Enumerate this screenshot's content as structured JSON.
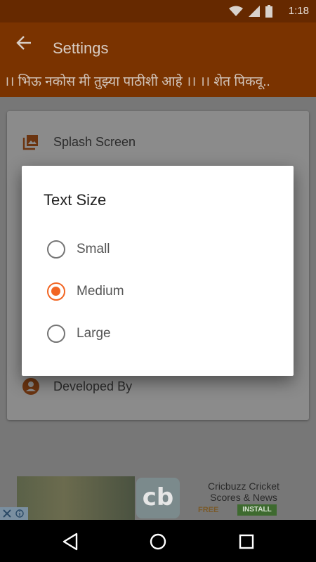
{
  "status_bar": {
    "time": "1:18"
  },
  "app_bar": {
    "title": "Settings"
  },
  "marquee": {
    "text": "।। भिऊ नकोस मी तुझ्या पाठीशी आहे ।। ।। शेत पिकवू.."
  },
  "settings": {
    "items": [
      {
        "label": "Splash Screen",
        "icon": "image-gallery-icon"
      },
      {
        "label": "Developed By",
        "icon": "account-icon"
      }
    ]
  },
  "dialog": {
    "title": "Text Size",
    "options": [
      {
        "label": "Small",
        "selected": false
      },
      {
        "label": "Medium",
        "selected": true
      },
      {
        "label": "Large",
        "selected": false
      }
    ]
  },
  "ad": {
    "app_name": "Cricbuzz Cricket Scores & News",
    "logo_text": "cb",
    "price": "FREE",
    "cta": "INSTALL"
  },
  "colors": {
    "accent": "#f26522",
    "app_bar": "#7a3300",
    "status_bar": "#662900"
  }
}
